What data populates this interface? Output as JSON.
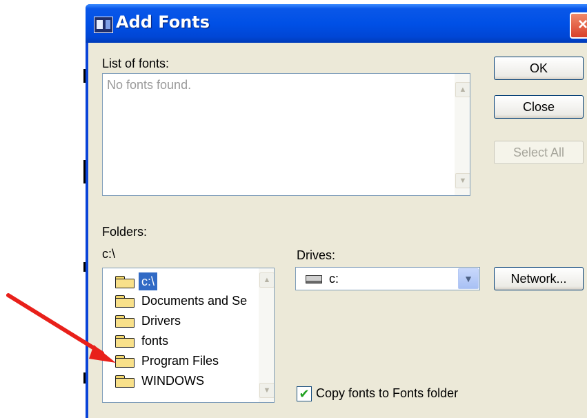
{
  "window": {
    "title": "Add Fonts",
    "close_glyph": "×"
  },
  "fonts_list": {
    "label": "List of fonts:",
    "empty_text": "No fonts found."
  },
  "buttons": {
    "ok": "OK",
    "close": "Close",
    "select_all": "Select All",
    "network": "Network..."
  },
  "folders": {
    "label": "Folders:",
    "current_path": "c:\\",
    "items": [
      {
        "label": "c:\\",
        "icon": "open-folder-icon",
        "selected": true
      },
      {
        "label": "Documents and Se",
        "icon": "folder-icon"
      },
      {
        "label": "Drivers",
        "icon": "folder-icon"
      },
      {
        "label": "fonts",
        "icon": "folder-icon"
      },
      {
        "label": "Program Files",
        "icon": "folder-icon"
      },
      {
        "label": "WINDOWS",
        "icon": "folder-icon"
      }
    ]
  },
  "drives": {
    "label": "Drives:",
    "selected": "c:"
  },
  "copy_option": {
    "label": "Copy fonts to Fonts folder",
    "checked": true
  },
  "scroll_glyphs": {
    "up": "▲",
    "down": "▼"
  },
  "colors": {
    "titlebar": "#0050e6",
    "face": "#ece9d8",
    "selection": "#316ac5",
    "annotation_arrow": "#e8201a",
    "check": "#21a121"
  }
}
